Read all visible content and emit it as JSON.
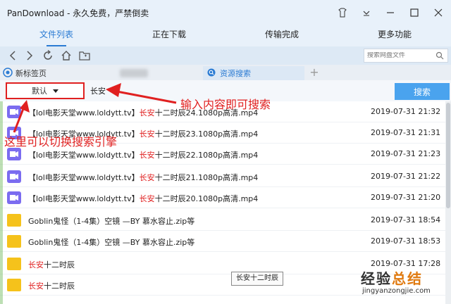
{
  "app": {
    "title": "PanDownload - 永久免费，严禁倒卖"
  },
  "tabs": [
    {
      "label": "文件列表",
      "active": true
    },
    {
      "label": "正在下载",
      "active": false
    },
    {
      "label": "传输完成",
      "active": false
    },
    {
      "label": "更多功能",
      "active": false
    }
  ],
  "toolbar": {
    "search_placeholder": "搜索网盘文件"
  },
  "browser_tabs": {
    "home_label": "新标签页",
    "resource_label": "资源搜索"
  },
  "search": {
    "engine": "默认",
    "query": "长安",
    "button_label": "搜索"
  },
  "files": [
    {
      "type": "video",
      "prefix": "【lol电影天堂www.loldytt.tv】",
      "highlight": "长安",
      "suffix": "十二时辰24.1080p高清.mp4",
      "date": "2019-07-31 21:32"
    },
    {
      "type": "video",
      "prefix": "【lol电影天堂www.loldytt.tv】",
      "highlight": "长安",
      "suffix": "十二时辰23.1080p高清.mp4",
      "date": "2019-07-31 21:31"
    },
    {
      "type": "video",
      "prefix": "【lol电影天堂www.loldytt.tv】",
      "highlight": "长安",
      "suffix": "十二时辰22.1080p高清.mp4",
      "date": "2019-07-31 21:23"
    },
    {
      "type": "video",
      "prefix": "【lol电影天堂www.loldytt.tv】",
      "highlight": "长安",
      "suffix": "十二时辰21.1080p高清.mp4",
      "date": "2019-07-31 21:22"
    },
    {
      "type": "video",
      "prefix": "【lol电影天堂www.loldytt.tv】",
      "highlight": "长安",
      "suffix": "十二时辰20.1080p高清.mp4",
      "date": "2019-07-31 21:20"
    },
    {
      "type": "folder",
      "prefix": "Goblin鬼怪（1-4集）空镜 —BY 慕水容止.zip等",
      "highlight": "",
      "suffix": "",
      "date": "2019-07-31 18:54"
    },
    {
      "type": "folder",
      "prefix": "Goblin鬼怪（1-4集）空镜 —BY 慕水容止.zip等",
      "highlight": "",
      "suffix": "",
      "date": "2019-07-31 18:53"
    },
    {
      "type": "folder",
      "prefix": "",
      "highlight": "长安",
      "suffix": "十二时辰",
      "date": "2019-07-31 17:28"
    },
    {
      "type": "folder",
      "prefix": "",
      "highlight": "长安",
      "suffix": "十二时辰",
      "date": ""
    }
  ],
  "tooltip": {
    "text": "长安十二时辰"
  },
  "annotations": {
    "input_hint": "输入内容即可搜索",
    "engine_hint": "这里可以切换搜索引擎"
  },
  "watermark": {
    "cn_a": "经验",
    "cn_b": "总结",
    "en": "jingyanzongjie.com"
  },
  "colors": {
    "accent": "#2b7bd3",
    "annotation": "#e02020",
    "search_button": "#4aa3ee"
  }
}
